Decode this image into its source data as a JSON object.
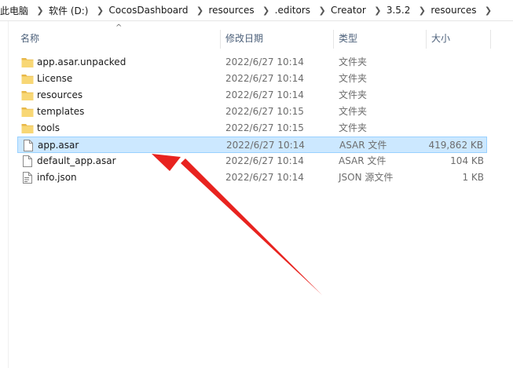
{
  "breadcrumb": [
    "此电脑",
    "软件 (D:)",
    "CocosDashboard",
    "resources",
    ".editors",
    "Creator",
    "3.5.2",
    "resources"
  ],
  "columns": {
    "name": "名称",
    "date": "修改日期",
    "type": "类型",
    "size": "大小"
  },
  "files": [
    {
      "name": "app.asar.unpacked",
      "date": "2022/6/27 10:14",
      "type": "文件夹",
      "size": "",
      "icon": "folder-icon"
    },
    {
      "name": "License",
      "date": "2022/6/27 10:14",
      "type": "文件夹",
      "size": "",
      "icon": "folder-icon"
    },
    {
      "name": "resources",
      "date": "2022/6/27 10:14",
      "type": "文件夹",
      "size": "",
      "icon": "folder-icon"
    },
    {
      "name": "templates",
      "date": "2022/6/27 10:15",
      "type": "文件夹",
      "size": "",
      "icon": "folder-icon"
    },
    {
      "name": "tools",
      "date": "2022/6/27 10:15",
      "type": "文件夹",
      "size": "",
      "icon": "folder-icon"
    },
    {
      "name": "app.asar",
      "date": "2022/6/27 10:14",
      "type": "ASAR 文件",
      "size": "419,862 KB",
      "icon": "file-icon",
      "selected": true
    },
    {
      "name": "default_app.asar",
      "date": "2022/6/27 10:14",
      "type": "ASAR 文件",
      "size": "104 KB",
      "icon": "file-icon"
    },
    {
      "name": "info.json",
      "date": "2022/6/27 10:14",
      "type": "JSON 源文件",
      "size": "1 KB",
      "icon": "json-file-icon"
    }
  ],
  "colors": {
    "selection_bg": "#cce8ff",
    "selection_border": "#99d1ff",
    "folder": "#f8d775",
    "annotation_arrow": "#e8231f"
  }
}
